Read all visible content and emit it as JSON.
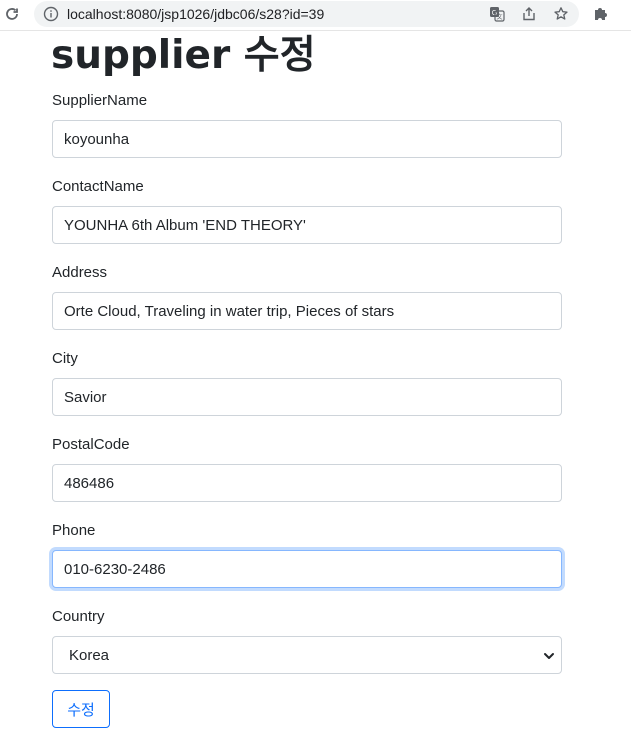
{
  "browser": {
    "url": "localhost:8080/jsp1026/jdbc06/s28?id=39",
    "icons": [
      "reload-icon",
      "info-icon",
      "translate-icon",
      "share-icon",
      "bookmark-star-icon",
      "extensions-icon"
    ]
  },
  "page": {
    "title": "supplier 수정"
  },
  "form": {
    "fields": [
      {
        "label": "SupplierName",
        "value": "koyounha"
      },
      {
        "label": "ContactName",
        "value": "YOUNHA 6th Album 'END THEORY'"
      },
      {
        "label": "Address",
        "value": "Orte Cloud, Traveling in water trip, Pieces of stars"
      },
      {
        "label": "City",
        "value": "Savior"
      },
      {
        "label": "PostalCode",
        "value": "486486"
      },
      {
        "label": "Phone",
        "value": "010-6230-2486"
      }
    ],
    "country": {
      "label": "Country",
      "selected": "Korea"
    },
    "submit_label": "수정"
  },
  "colors": {
    "primary": "#0d6efd",
    "focus_border": "#86b7fe",
    "input_border": "#ced4da",
    "text": "#212529"
  }
}
